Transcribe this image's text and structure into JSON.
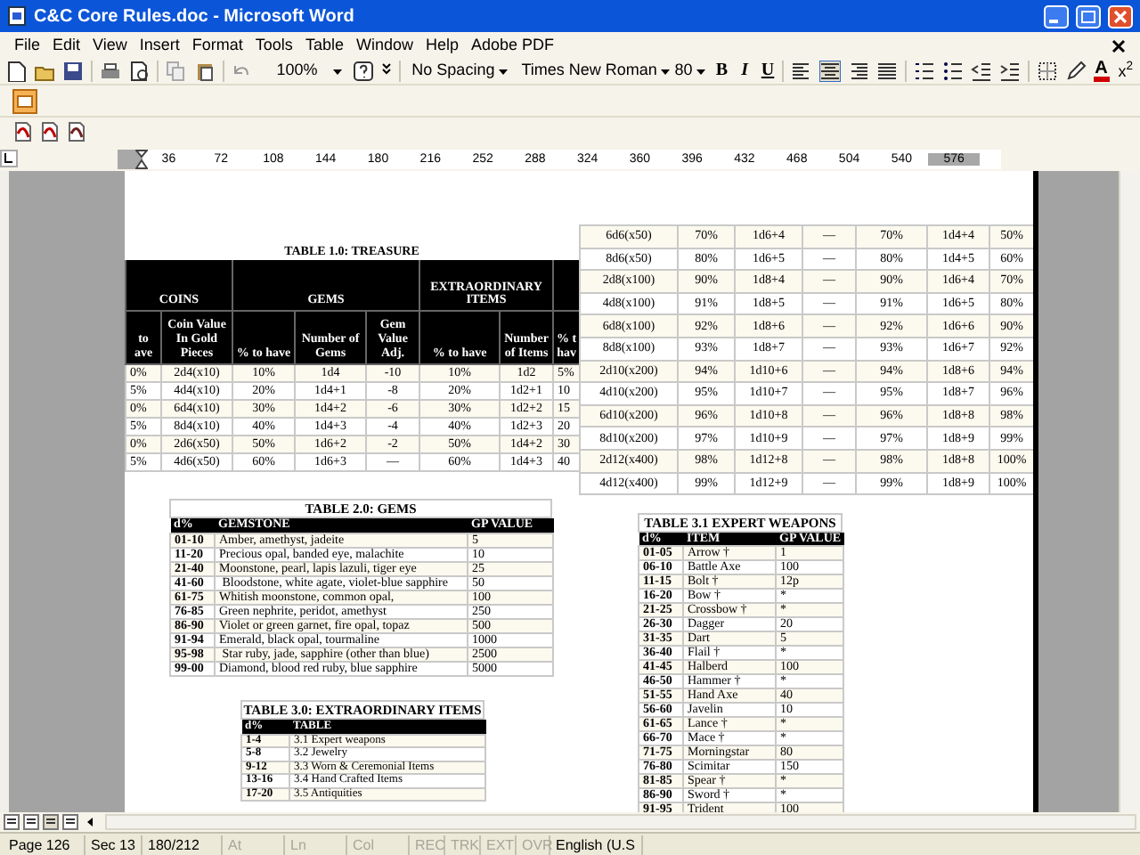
{
  "window": {
    "title": "C&C Core Rules.doc - Microsoft Word"
  },
  "menu": [
    "File",
    "Edit",
    "View",
    "Insert",
    "Format",
    "Tools",
    "Table",
    "Window",
    "Help",
    "Adobe PDF"
  ],
  "toolbar": {
    "zoom": "100%",
    "style": "No Spacing",
    "font": "Times New Roman",
    "size": "80",
    "bold": "B",
    "italic": "I",
    "underline": "U",
    "font_color": "A",
    "superscript": "x$^{2}$",
    "alignment": [
      {
        "selected": false
      },
      {
        "selected": true
      },
      {
        "selected": false
      },
      {
        "selected": false
      }
    ]
  },
  "ruler": [
    "36",
    "72",
    "108",
    "144",
    "180",
    "216",
    "252",
    "288",
    "324",
    "360",
    "396",
    "432",
    "468",
    "504",
    "540",
    "576"
  ],
  "treasure_table": {
    "title": "TABLE 1.0: TREASURE",
    "groups": [
      "COINS",
      "GEMS",
      "EXTRAORDINARY ITEMS"
    ],
    "columns": [
      "to ave",
      "Coin Value In Gold Pieces",
      "% to have",
      "Number of Gems",
      "Gem Value Adj.",
      "% to have",
      "Number of Items",
      "% t hav"
    ],
    "rows": [
      [
        "0%",
        "2d4(x10)",
        "10%",
        "1d4",
        "-10",
        "10%",
        "1d2",
        "5%"
      ],
      [
        "5%",
        "4d4(x10)",
        "20%",
        "1d4+1",
        "-8",
        "20%",
        "1d2+1",
        "10"
      ],
      [
        "0%",
        "6d4(x10)",
        "30%",
        "1d4+2",
        "-6",
        "30%",
        "1d2+2",
        "15"
      ],
      [
        "5%",
        "8d4(x10)",
        "40%",
        "1d4+3",
        "-4",
        "40%",
        "1d2+3",
        "20"
      ],
      [
        "0%",
        "2d6(x50)",
        "50%",
        "1d6+2",
        "-2",
        "50%",
        "1d4+2",
        "30"
      ],
      [
        "5%",
        "4d6(x50)",
        "60%",
        "1d6+3",
        "—",
        "60%",
        "1d4+3",
        "40"
      ]
    ]
  },
  "treasure_continued": {
    "rows": [
      [
        "6d6(x50)",
        "70%",
        "1d6+4",
        "—",
        "70%",
        "1d4+4",
        "50%"
      ],
      [
        "8d6(x50)",
        "80%",
        "1d6+5",
        "—",
        "80%",
        "1d4+5",
        "60%"
      ],
      [
        "2d8(x100)",
        "90%",
        "1d8+4",
        "—",
        "90%",
        "1d6+4",
        "70%"
      ],
      [
        "4d8(x100)",
        "91%",
        "1d8+5",
        "—",
        "91%",
        "1d6+5",
        "80%"
      ],
      [
        "6d8(x100)",
        "92%",
        "1d8+6",
        "—",
        "92%",
        "1d6+6",
        "90%"
      ],
      [
        "8d8(x100)",
        "93%",
        "1d8+7",
        "—",
        "93%",
        "1d6+7",
        "92%"
      ],
      [
        "2d10(x200)",
        "94%",
        "1d10+6",
        "—",
        "94%",
        "1d8+6",
        "94%"
      ],
      [
        "4d10(x200)",
        "95%",
        "1d10+7",
        "—",
        "95%",
        "1d8+7",
        "96%"
      ],
      [
        "6d10(x200)",
        "96%",
        "1d10+8",
        "—",
        "96%",
        "1d8+8",
        "98%"
      ],
      [
        "8d10(x200)",
        "97%",
        "1d10+9",
        "—",
        "97%",
        "1d8+9",
        "99%"
      ],
      [
        "2d12(x400)",
        "98%",
        "1d12+8",
        "—",
        "98%",
        "1d8+8",
        "100%"
      ],
      [
        "4d12(x400)",
        "99%",
        "1d12+9",
        "—",
        "99%",
        "1d8+9",
        "100%"
      ]
    ]
  },
  "gems_table": {
    "title": "TABLE 2.0: GEMS",
    "columns": [
      "d%",
      "GEMSTONE",
      "GP VALUE"
    ],
    "rows": [
      [
        "01-10",
        "Amber, amethyst, jadeite",
        "5"
      ],
      [
        "11-20",
        "Precious opal, banded eye, malachite",
        "10"
      ],
      [
        "21-40",
        "Moonstone, pearl, lapis lazuli, tiger eye",
        "25"
      ],
      [
        "41-60",
        " Bloodstone, white agate, violet-blue sapphire",
        "50"
      ],
      [
        "61-75",
        "Whitish moonstone, common opal,",
        "100"
      ],
      [
        "76-85",
        "Green nephrite, peridot, amethyst",
        "250"
      ],
      [
        "86-90",
        "Violet or green garnet, fire opal, topaz",
        "500"
      ],
      [
        "91-94",
        "Emerald, black opal, tourmaline",
        "1000"
      ],
      [
        "95-98",
        " Star ruby, jade, sapphire (other than blue)",
        "2500"
      ],
      [
        "99-00",
        "Diamond, blood red ruby, blue sapphire",
        "5000"
      ]
    ]
  },
  "extraordinary_items_table": {
    "title": "TABLE 3.0: EXTRAORDINARY ITEMS",
    "columns": [
      "d%",
      "TABLE"
    ],
    "rows": [
      [
        "1-4",
        "3.1 Expert weapons"
      ],
      [
        "5-8",
        "3.2 Jewelry"
      ],
      [
        "9-12",
        "3.3 Worn & Ceremonial Items"
      ],
      [
        "13-16",
        "3.4 Hand Crafted Items"
      ],
      [
        "17-20",
        "3.5 Antiquities"
      ]
    ]
  },
  "expert_weapons_table": {
    "title": "TABLE 3.1 EXPERT WEAPONS",
    "columns": [
      "d%",
      "ITEM",
      "GP VALUE"
    ],
    "rows": [
      [
        "01-05",
        "Arrow †",
        "1"
      ],
      [
        "06-10",
        "Battle Axe",
        "100"
      ],
      [
        "11-15",
        "Bolt †",
        "12p"
      ],
      [
        "16-20",
        "Bow †",
        "*"
      ],
      [
        "21-25",
        "Crossbow †",
        "*"
      ],
      [
        "26-30",
        "Dagger",
        "20"
      ],
      [
        "31-35",
        "Dart",
        "5"
      ],
      [
        "36-40",
        "Flail †",
        "*"
      ],
      [
        "41-45",
        "Halberd",
        "100"
      ],
      [
        "46-50",
        "Hammer †",
        "*"
      ],
      [
        "51-55",
        "Hand Axe",
        "40"
      ],
      [
        "56-60",
        "Javelin",
        "10"
      ],
      [
        "61-65",
        "Lance †",
        "*"
      ],
      [
        "66-70",
        "Mace †",
        "*"
      ],
      [
        "71-75",
        "Morningstar",
        "80"
      ],
      [
        "76-80",
        "Scimitar",
        "150"
      ],
      [
        "81-85",
        "Spear †",
        "*"
      ],
      [
        "86-90",
        "Sword †",
        "*"
      ],
      [
        "91-95",
        "Trident",
        "100"
      ]
    ]
  },
  "status_bar": [
    {
      "text": "Page 126",
      "disabled": false
    },
    {
      "text": "Sec 13",
      "disabled": false
    },
    {
      "text": "180/212",
      "disabled": false
    },
    {
      "text": "At",
      "disabled": true
    },
    {
      "text": "Ln",
      "disabled": true
    },
    {
      "text": "Col",
      "disabled": true
    },
    {
      "text": "REC",
      "disabled": true
    },
    {
      "text": "TRK",
      "disabled": true
    },
    {
      "text": "EXT",
      "disabled": true
    },
    {
      "text": "OVR",
      "disabled": true
    },
    {
      "text": "English (U.S",
      "disabled": false
    }
  ]
}
